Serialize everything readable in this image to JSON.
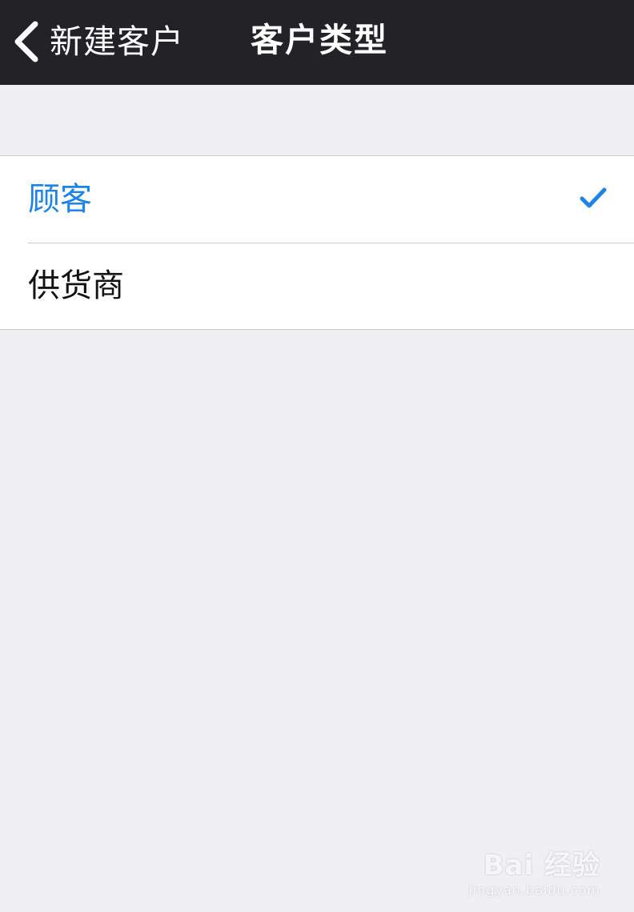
{
  "navbar": {
    "back_label": "新建客户",
    "title": "客户类型"
  },
  "options": [
    {
      "label": "顾客",
      "selected": true
    },
    {
      "label": "供货商",
      "selected": false
    }
  ],
  "colors": {
    "navbar_bg": "#232327",
    "accent": "#1a84e8",
    "background": "#efeff4"
  },
  "watermark": {
    "main": "Bai 经验",
    "sub": "jingyan.baidu.com"
  }
}
